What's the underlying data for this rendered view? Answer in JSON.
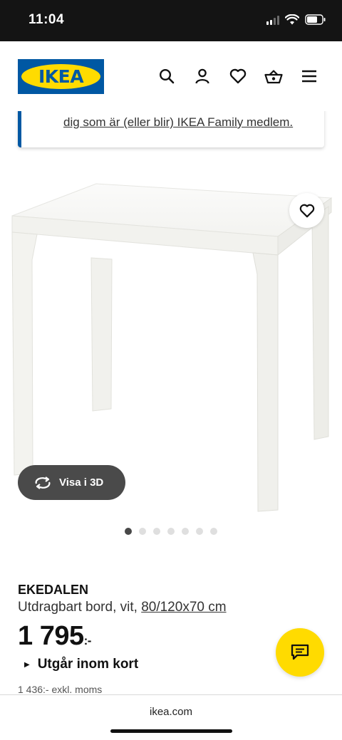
{
  "status_bar": {
    "time": "11:04"
  },
  "header": {
    "logo_text": "IKEA",
    "icons": [
      "search-icon",
      "user-icon",
      "heart-icon",
      "basket-icon",
      "menu-icon"
    ]
  },
  "banner": {
    "text": "dig som är (eller blir) IKEA Family medlem."
  },
  "media": {
    "view_3d_label": "Visa i 3D",
    "carousel_count": 7,
    "carousel_active": 0
  },
  "product": {
    "name": "EKEDALEN",
    "description": "Utdragbart bord, vit,",
    "dimensions": "80/120x70 cm",
    "price": "1 795",
    "price_suffix": ":-",
    "stock_status": "Utgår inom kort",
    "excl_vat": "1 436:- exkl. moms"
  },
  "browser": {
    "url": "ikea.com"
  },
  "colors": {
    "brand_blue": "#0058a3",
    "brand_yellow": "#ffdb00",
    "dark": "#111111"
  }
}
